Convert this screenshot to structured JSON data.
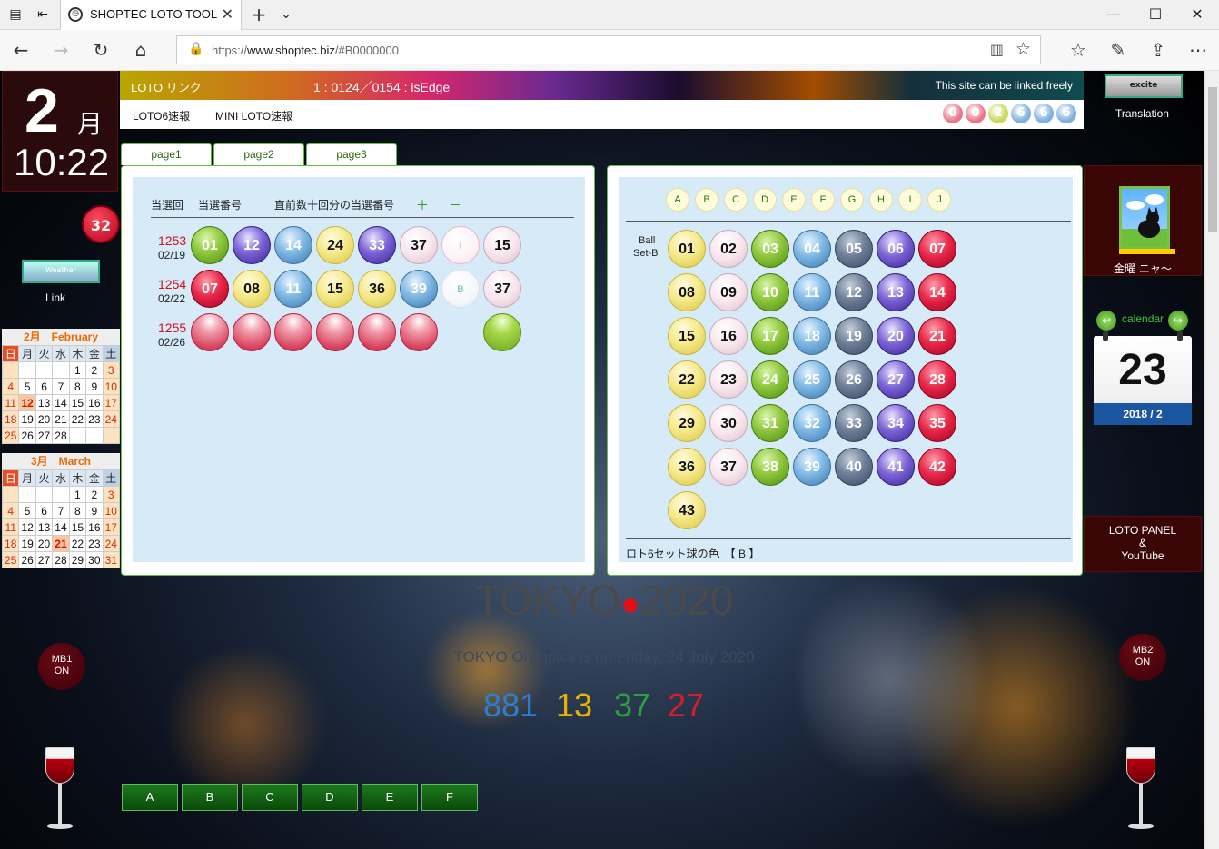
{
  "browser": {
    "tab_title": "SHOPTEC LOTO TOOL",
    "url_prefix": "https://",
    "url_host": "www.shoptec.biz",
    "url_path": "/#B0000000"
  },
  "clock": {
    "day": "2",
    "month_char": "月",
    "time": "10:22",
    "badge": "32"
  },
  "left": {
    "weather_label": "Weather",
    "link_label": "Link"
  },
  "cal_feb": {
    "title": "2月　February",
    "weekdays": [
      "日",
      "月",
      "火",
      "水",
      "木",
      "金",
      "土"
    ],
    "rows": [
      [
        "",
        "",
        "",
        "",
        "1",
        "2",
        "3"
      ],
      [
        "4",
        "5",
        "6",
        "7",
        "8",
        "9",
        "10"
      ],
      [
        "11",
        "12",
        "13",
        "14",
        "15",
        "16",
        "17"
      ],
      [
        "18",
        "19",
        "20",
        "21",
        "22",
        "23",
        "24"
      ],
      [
        "25",
        "26",
        "27",
        "28",
        "",
        "",
        ""
      ]
    ]
  },
  "cal_mar": {
    "title": "3月　March",
    "weekdays": [
      "日",
      "月",
      "火",
      "水",
      "木",
      "金",
      "土"
    ],
    "rows": [
      [
        "",
        "",
        "",
        "",
        "1",
        "2",
        "3"
      ],
      [
        "4",
        "5",
        "6",
        "7",
        "8",
        "9",
        "10"
      ],
      [
        "11",
        "12",
        "13",
        "14",
        "15",
        "16",
        "17"
      ],
      [
        "18",
        "19",
        "20",
        "21",
        "22",
        "23",
        "24"
      ],
      [
        "25",
        "26",
        "27",
        "28",
        "29",
        "30",
        "31"
      ]
    ]
  },
  "header": {
    "title": "LOTO リンク",
    "status": "1 : 0124／0154 : isEdge",
    "free_link": "This site can be linked freely",
    "nav_loto6": "LOTO6速報",
    "nav_mini": "MINI LOTO速報",
    "counter": [
      "0",
      "0",
      "2",
      "6",
      "6",
      "6"
    ],
    "counter_colors": [
      "#e8778a",
      "#e8778a",
      "#c8d85a",
      "#7fb0e0",
      "#7fb0e0",
      "#7fb0e0"
    ]
  },
  "tabs": [
    "page1",
    "page2",
    "page3"
  ],
  "left_panel": {
    "col_round": "当選回",
    "col_numbers": "当選番号",
    "col_recent": "直前数十回分の当選番号",
    "plus": "＋",
    "minus": "－",
    "draws": [
      {
        "round": "1253",
        "date": "02/19",
        "balls": [
          {
            "n": "01",
            "c": "green"
          },
          {
            "n": "12",
            "c": "purple"
          },
          {
            "n": "14",
            "c": "blue"
          },
          {
            "n": "24",
            "c": "yellow"
          },
          {
            "n": "33",
            "c": "purple"
          },
          {
            "n": "37",
            "c": "pink"
          },
          {
            "n": "I",
            "c": "ghostpink"
          },
          {
            "n": "15",
            "c": "pink"
          }
        ]
      },
      {
        "round": "1254",
        "date": "02/22",
        "balls": [
          {
            "n": "07",
            "c": "red"
          },
          {
            "n": "08",
            "c": "yellow"
          },
          {
            "n": "11",
            "c": "blue"
          },
          {
            "n": "15",
            "c": "yellow"
          },
          {
            "n": "36",
            "c": "yellow"
          },
          {
            "n": "39",
            "c": "blue"
          },
          {
            "n": "B",
            "c": "ghost"
          },
          {
            "n": "37",
            "c": "pink"
          }
        ]
      },
      {
        "round": "1255",
        "date": "02/26",
        "balls": [
          {
            "n": "",
            "c": "blankred"
          },
          {
            "n": "",
            "c": "blankred"
          },
          {
            "n": "",
            "c": "blankred"
          },
          {
            "n": "",
            "c": "blankred"
          },
          {
            "n": "",
            "c": "blankred"
          },
          {
            "n": "",
            "c": "blankred"
          },
          {
            "n": "",
            "c": "none"
          },
          {
            "n": "",
            "c": "blankgreen"
          }
        ]
      }
    ]
  },
  "right_panel": {
    "letters": [
      "A",
      "B",
      "C",
      "D",
      "E",
      "F",
      "G",
      "H",
      "I",
      "J"
    ],
    "ball_label_1": "Ball",
    "ball_label_2": "Set-B",
    "column_colors": [
      "yellow",
      "pink",
      "green",
      "blue",
      "slate",
      "purple",
      "red"
    ],
    "numbers": [
      "01",
      "02",
      "03",
      "04",
      "05",
      "06",
      "07",
      "08",
      "09",
      "10",
      "11",
      "12",
      "13",
      "14",
      "15",
      "16",
      "17",
      "18",
      "19",
      "20",
      "21",
      "22",
      "23",
      "24",
      "25",
      "26",
      "27",
      "28",
      "29",
      "30",
      "31",
      "32",
      "33",
      "34",
      "35",
      "36",
      "37",
      "38",
      "39",
      "40",
      "41",
      "42",
      "43"
    ],
    "footer": "ロト6セット球の色　【 B 】"
  },
  "right_col": {
    "excite_label": "excite",
    "translation": "Translation",
    "cat_label": "金曜 ニャ～",
    "calendar_label": "calendar",
    "cal_day": "23",
    "cal_ym": "2018 / 2",
    "yt_line1": "LOTO PANEL",
    "yt_line2": "&",
    "yt_line3": "YouTube"
  },
  "mb1": {
    "line1": "MB1",
    "line2": "ON"
  },
  "mb2": {
    "line1": "MB2",
    "line2": "ON"
  },
  "tokyo": {
    "left": "TOKYO",
    "right": "2020",
    "sub": "TOKYO Olympics is on Friday, 24 July 2020",
    "days": "881",
    "hours": "13",
    "mins": "37",
    "secs": "27",
    "colors": [
      "#2a7fd4",
      "#e8b400",
      "#2aa040",
      "#d41e2e"
    ]
  },
  "buttons": [
    "A",
    "B",
    "C",
    "D",
    "E",
    "F"
  ]
}
